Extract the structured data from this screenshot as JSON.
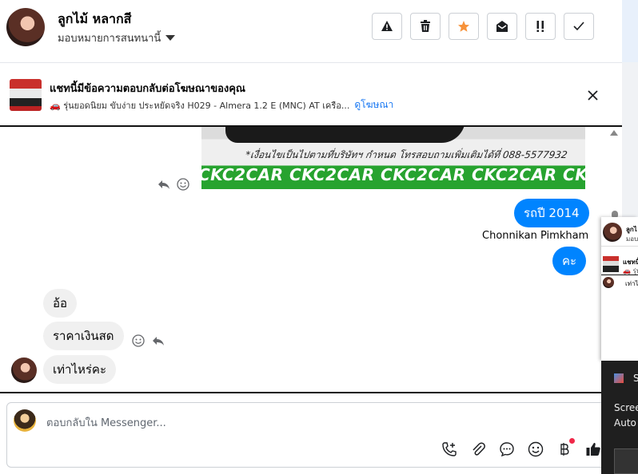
{
  "header": {
    "contact_name": "ลูกไม้ หลากสี",
    "assign_label": "มอบหมายการสนทนานี้",
    "toolbar": {
      "spam_icon": "warning-icon",
      "delete_icon": "trash-icon",
      "star_icon": "star-icon",
      "mark_unread_icon": "envelope-open-icon",
      "follow_up_icon": "double-exclamation-icon",
      "done_icon": "check-icon",
      "star_color": "#f7923a"
    }
  },
  "ad_banner": {
    "title": "แชทนี้มีข้อความตอบกลับต่อโฆษณาของคุณ",
    "description": "🚗 รุ่นยอดนิยม ขับง่าย ประหยัดจริง H029 - Almera 1.2 E (MNC) AT เครือ...",
    "link_label": "ดูโฆษณา"
  },
  "messages": {
    "image_phone_text": "*เงื่อนไขเป็นไปตามที่บริษัทฯ กำหนด โทรสอบถามเพิ่มเติมได้ที่ 088-5577932",
    "image_band_text": "CKC2CAR CKC2CAR CKC2CAR CKC2CAR CKC2",
    "outgoing_1": "รถปี 2014",
    "sender_name": "Chonnikan Pimkham",
    "outgoing_2": "คะ",
    "incoming_1": "อ้อ",
    "incoming_2": "ราคาเงินสด",
    "incoming_3": "เท่าไหร่คะ",
    "out_color": "#0084ff",
    "in_color": "#f0f0f0"
  },
  "composer": {
    "placeholder": "ตอบกลับใน Messenger...",
    "icons": [
      "phone-add-icon",
      "paperclip-icon",
      "quick-reply-icon",
      "emoji-icon",
      "baht-payment-icon",
      "thumbs-up-icon"
    ],
    "notify_color": "#f02849"
  },
  "side_panel": {
    "mini_name": "ลูกไ",
    "mini_sub": "มอบ",
    "mini_ad": "แชทนี้",
    "mini_ad_sub": "🚗 รุ่น",
    "mini_msg": "เท่าไ"
  },
  "toast": {
    "line1": "S",
    "line2": "Scree",
    "line3": "Auto"
  }
}
